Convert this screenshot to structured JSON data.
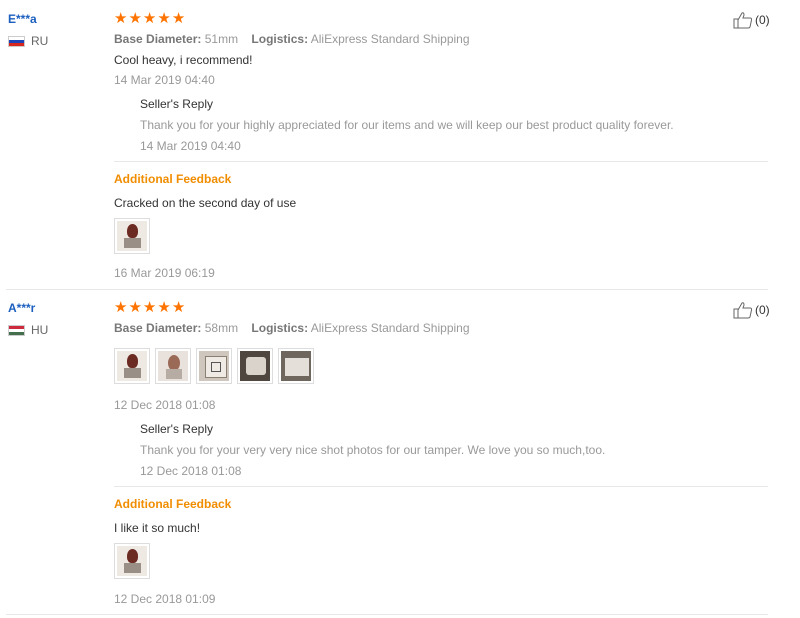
{
  "reviews": [
    {
      "user": "E***a",
      "country": "RU",
      "flag": "flag-ru",
      "rating_stars": 5,
      "attrs": [
        {
          "key": "Base Diameter:",
          "value": "51mm"
        },
        {
          "key": "Logistics:",
          "value": "AliExpress Standard Shipping"
        }
      ],
      "text": "Cool heavy, i recommend!",
      "date": "14 Mar 2019 04:40",
      "helpful_count": "(0)",
      "reply": {
        "title": "Seller's Reply",
        "text": "Thank you for your highly appreciated for our items and we will keep our best product quality forever.",
        "date": "14 Mar 2019 04:40"
      },
      "additional": {
        "title": "Additional Feedback",
        "text": "Cracked on the second day of use",
        "date": "16 Mar 2019 06:19"
      }
    },
    {
      "user": "A***r",
      "country": "HU",
      "flag": "flag-hu",
      "rating_stars": 5,
      "attrs": [
        {
          "key": "Base Diameter:",
          "value": "58mm"
        },
        {
          "key": "Logistics:",
          "value": "AliExpress Standard Shipping"
        }
      ],
      "date": "12 Dec 2018 01:08",
      "helpful_count": "(0)",
      "reply": {
        "title": "Seller's Reply",
        "text": "Thank you for your very very nice shot photos for our tamper. We love you so much,too.",
        "date": "12 Dec 2018 01:08"
      },
      "additional": {
        "title": "Additional Feedback",
        "text": "I like it so much!",
        "date": "12 Dec 2018 01:09"
      }
    }
  ],
  "icons": {
    "star": "★",
    "thumbs_up": "thumbs-up-icon"
  },
  "colors": {
    "star": "#ff7300",
    "user_link": "#1b5fbf",
    "additional_feedback": "#f08d00"
  }
}
